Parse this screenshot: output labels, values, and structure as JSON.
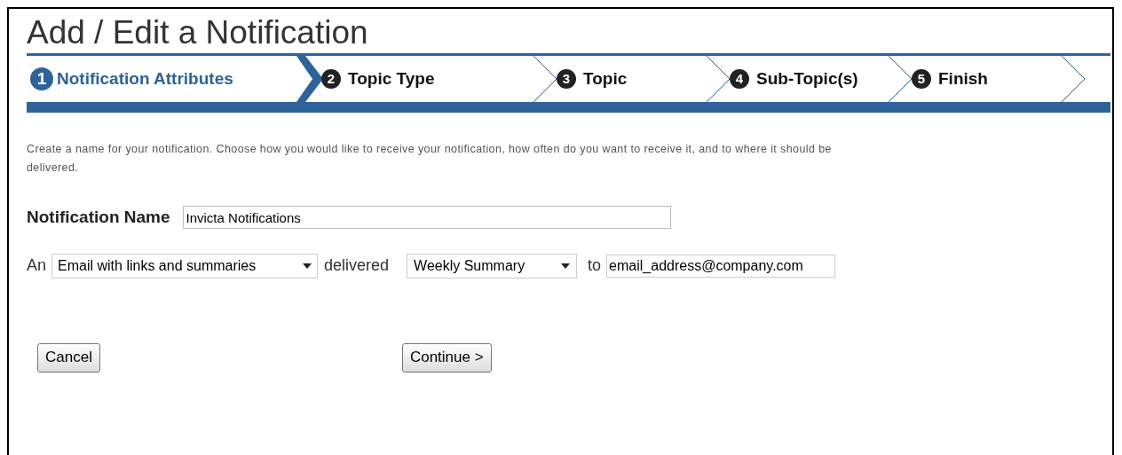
{
  "title": "Add / Edit a Notification",
  "steps": [
    {
      "number": "1",
      "label": "Notification Attributes",
      "selected": true
    },
    {
      "number": "2",
      "label": "Topic Type",
      "selected": false
    },
    {
      "number": "3",
      "label": "Topic",
      "selected": false
    },
    {
      "number": "4",
      "label": "Sub-Topic(s)",
      "selected": false
    },
    {
      "number": "5",
      "label": "Finish",
      "selected": false
    }
  ],
  "intro": "Create a name for your notification. Choose how you would like to receive your notification, how often do you want to receive it, and to where it should be delivered.",
  "name_field": {
    "label": "Notification Name",
    "value": "Invicta Notifications"
  },
  "delivery": {
    "prefix": "An",
    "method": "Email with links and summaries",
    "middle": "delivered",
    "frequency": "Weekly Summary",
    "to": "to",
    "address": "email_address@company.com"
  },
  "buttons": {
    "cancel": "Cancel",
    "continue": "Continue >"
  }
}
